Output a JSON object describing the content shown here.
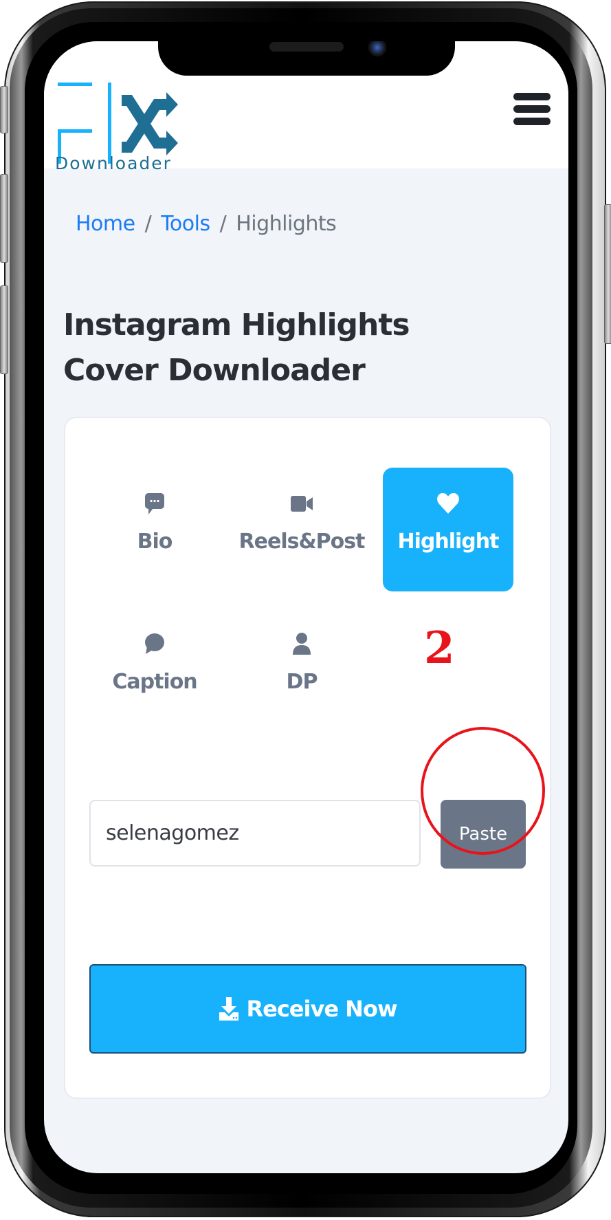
{
  "logo": {
    "brand_mark": "FIX",
    "subtitle": "Downloader",
    "colors": {
      "light": "#17b2fb",
      "dark": "#1f6e94"
    }
  },
  "header": {
    "menu_icon": "hamburger-menu-icon"
  },
  "breadcrumb": {
    "items": [
      {
        "label": "Home",
        "link": true
      },
      {
        "label": "Tools",
        "link": true
      },
      {
        "label": "Highlights",
        "link": false
      }
    ],
    "separator": "/"
  },
  "page": {
    "title": "Instagram Highlights Cover Downloader"
  },
  "tabs": [
    {
      "label": "Bio",
      "icon": "comment-dots-icon",
      "active": false
    },
    {
      "label": "Reels&Post",
      "icon": "video-camera-icon",
      "active": false
    },
    {
      "label": "Highlight",
      "icon": "heart-icon",
      "active": true
    },
    {
      "label": "Caption",
      "icon": "comment-icon",
      "active": false
    },
    {
      "label": "DP",
      "icon": "user-icon",
      "active": false
    }
  ],
  "form": {
    "username_value": "selenagomez",
    "paste_label": "Paste",
    "submit_label": "Receive Now",
    "submit_icon": "download-icon"
  },
  "annotation": {
    "step_number": "2",
    "color": "#e8141b"
  },
  "colors": {
    "accent": "#17b2fb",
    "muted": "#6b7588",
    "link": "#1a7cf5",
    "background": "#f1f4f9"
  }
}
